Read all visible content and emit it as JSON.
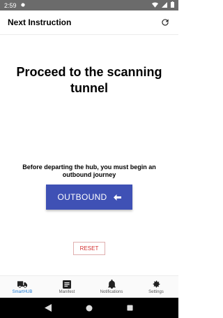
{
  "status_bar": {
    "time": "2:59"
  },
  "app_bar": {
    "title": "Next Instruction"
  },
  "main": {
    "headline": "Proceed to the scanning tunnel",
    "note": "Before departing the hub, you must begin an outbound journey",
    "outbound_label": "OUTBOUND",
    "reset_label": "RESET"
  },
  "bottom_nav": {
    "items": [
      {
        "label": "SmartHUB",
        "icon": "truck-icon",
        "active": true
      },
      {
        "label": "Manifest",
        "icon": "manifest-icon",
        "active": false
      },
      {
        "label": "Notifications",
        "icon": "bell-icon",
        "active": false
      },
      {
        "label": "Settings",
        "icon": "gear-icon",
        "active": false
      }
    ]
  },
  "colors": {
    "accent": "#3f51b5",
    "active_nav": "#1976d2",
    "reset": "#d32f2f"
  }
}
